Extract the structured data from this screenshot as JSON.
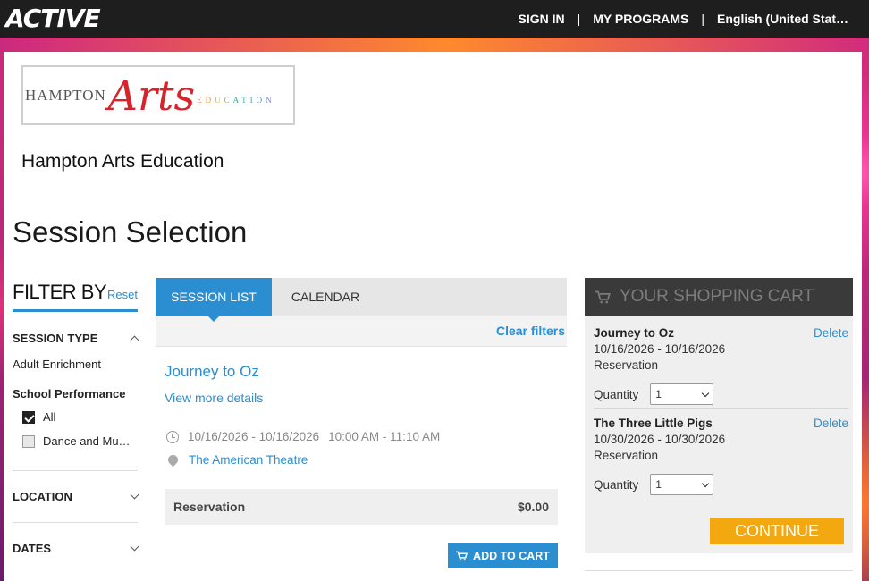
{
  "brand": {
    "logo": "ACTIVE"
  },
  "top_nav": {
    "sign_in": "SIGN IN",
    "separator": "|",
    "my_programs": "MY PROGRAMS",
    "language": "English (United Stat…"
  },
  "org": {
    "logo": {
      "hampton": "HAMPTON",
      "arts": "Arts",
      "education": "EDUCATION"
    },
    "name": "Hampton Arts Education"
  },
  "page_title": "Session Selection",
  "filter": {
    "title": "FILTER BY",
    "reset": "Reset",
    "session_type": {
      "label": "SESSION TYPE",
      "items": [
        "Adult Enrichment",
        "School Performance"
      ],
      "options": [
        {
          "label": "All",
          "checked": true
        },
        {
          "label": "Dance and Mu…",
          "checked": false
        }
      ]
    },
    "location": "LOCATION",
    "dates": "DATES"
  },
  "tabs": {
    "session_list": "SESSION LIST",
    "calendar": "CALENDAR"
  },
  "clear_filters": "Clear filters",
  "session": {
    "title": "Journey to Oz",
    "view_more": "View more details",
    "dates": "10/16/2026 - 10/16/2026",
    "time": "10:00 AM - 11:10 AM",
    "location": "The American Theatre",
    "fee_label": "Reservation",
    "fee_amount": "$0.00",
    "add_to_cart": "ADD TO CART"
  },
  "cart": {
    "title": "YOUR SHOPPING CART",
    "items": [
      {
        "name": "Journey to Oz",
        "delete": "Delete",
        "dates": "10/16/2026 - 10/16/2026",
        "type": "Reservation",
        "quantity_label": "Quantity",
        "quantity": "1"
      },
      {
        "name": "The Three Little Pigs",
        "delete": "Delete",
        "dates": "10/30/2026 - 10/30/2026",
        "type": "Reservation",
        "quantity_label": "Quantity",
        "quantity": "1"
      }
    ],
    "continue": "CONTINUE"
  },
  "colors": {
    "accent": "#2a8ed0",
    "continue": "#f3a80f",
    "topbar": "#1e1e1e",
    "cart_header": "#3a3a3a"
  }
}
